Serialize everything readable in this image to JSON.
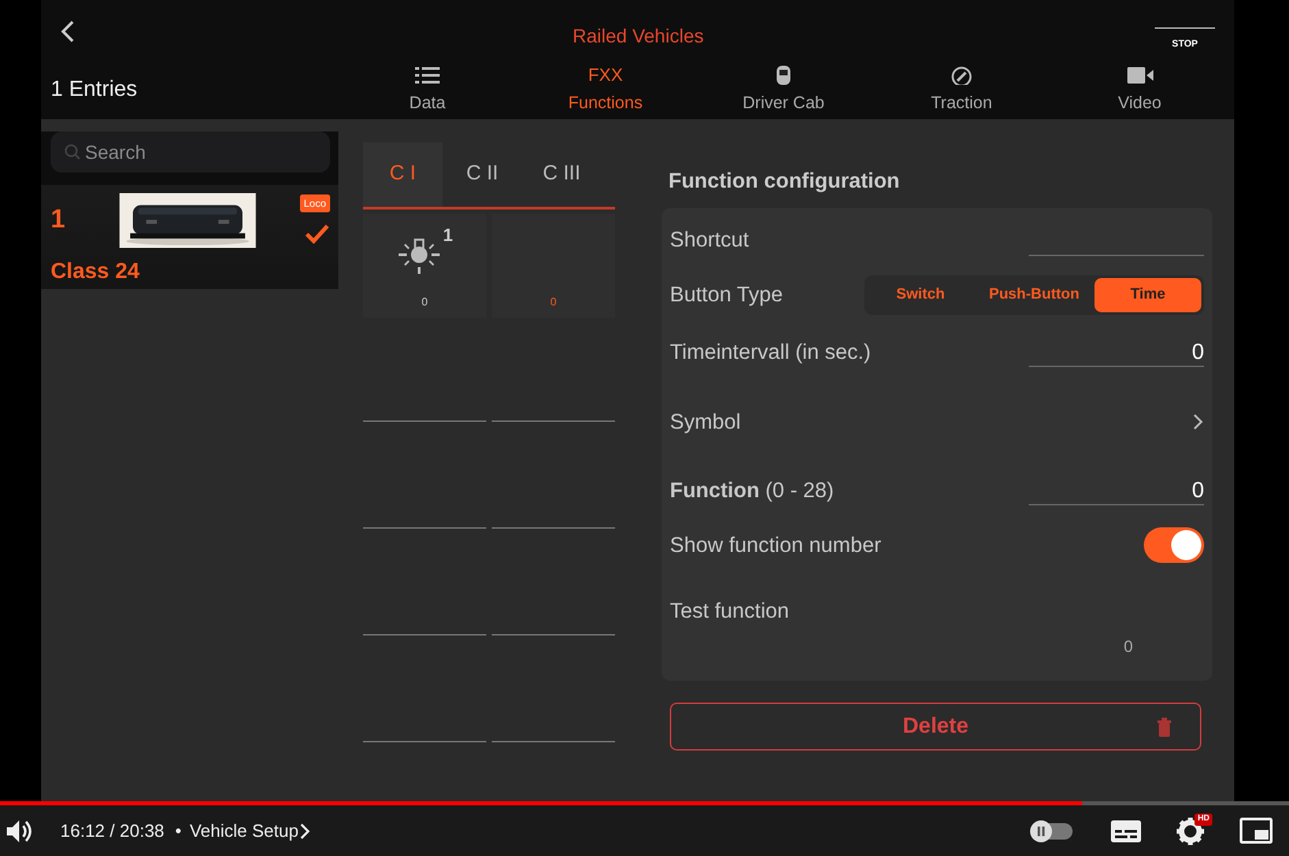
{
  "app_bar": {
    "title": "Railed Vehicles",
    "stop": "STOP"
  },
  "tabs": [
    {
      "label": "Data",
      "kind": "list",
      "selected": false
    },
    {
      "label": "Functions",
      "kind": "text",
      "glyph": "FXX",
      "selected": true
    },
    {
      "label": "Driver Cab",
      "kind": "train",
      "selected": false
    },
    {
      "label": "Traction",
      "kind": "gauge",
      "selected": false
    },
    {
      "label": "Video",
      "kind": "camera",
      "selected": false
    }
  ],
  "vehicle_list": {
    "count": "1 Entries",
    "search": {
      "placeholder": "Search"
    },
    "items": [
      {
        "number": "1",
        "name": "Class 24",
        "tag": "Loco",
        "selected": true
      }
    ]
  },
  "function_groups": [
    {
      "label": "C I",
      "selected": true
    },
    {
      "label": "C II",
      "selected": false
    },
    {
      "label": "C III",
      "selected": false
    }
  ],
  "function_slots": [
    {
      "kind": "bulb",
      "number": "1",
      "value": "0",
      "selected": false
    },
    {
      "kind": "empty",
      "value": "0",
      "selected": true
    }
  ],
  "config": {
    "title": "Function configuration",
    "rows": [
      {
        "kind": "field",
        "label": "Shortcut"
      },
      {
        "kind": "segmented",
        "label": "Button Type",
        "options": [
          {
            "label": "Switch",
            "selected": false
          },
          {
            "label": "Push-Button",
            "selected": false
          },
          {
            "label": "Time",
            "selected": true
          }
        ]
      },
      {
        "kind": "field",
        "label": "Timeintervall (in sec.)",
        "value": "0"
      },
      {
        "kind": "link",
        "label": "Symbol"
      },
      {
        "kind": "field",
        "label": "**Function** (0 - 28)",
        "value": "0"
      },
      {
        "kind": "toggle",
        "label": "Show function number",
        "on": true
      },
      {
        "kind": "test",
        "label": "Test function",
        "value": "0"
      }
    ],
    "delete": "Delete"
  },
  "player": {
    "progress": {
      "level": 0.84
    },
    "time": "16:12 / 20:38",
    "separator": "•",
    "chapter": "Vehicle Setup",
    "badge": "HD"
  }
}
